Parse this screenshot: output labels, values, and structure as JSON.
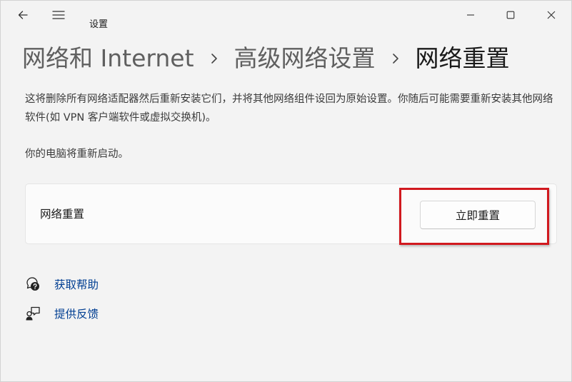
{
  "window": {
    "title": "设置",
    "controls": [
      "minimize-icon",
      "maximize-icon",
      "close-icon"
    ]
  },
  "breadcrumb": {
    "items": [
      "网络和 Internet",
      "高级网络设置"
    ],
    "current": "网络重置",
    "separator_icon": "chevron-right-icon"
  },
  "description": "这将删除所有网络适配器然后重新安装它们，并将其他网络组件设回为原始设置。你随后可能需要重新安装其他网络软件(如 VPN 客户端软件或虚拟交换机)。",
  "restart_note": "你的电脑将重新启动。",
  "reset_card": {
    "label": "网络重置",
    "button_label": "立即重置"
  },
  "links": [
    {
      "label": "获取帮助",
      "icon": "help-chat-icon"
    },
    {
      "label": "提供反馈",
      "icon": "feedback-icon"
    }
  ],
  "colors": {
    "background": "#f3f3f3",
    "card": "#fbfbfb",
    "link": "#003e92",
    "highlight": "#d1191f"
  }
}
